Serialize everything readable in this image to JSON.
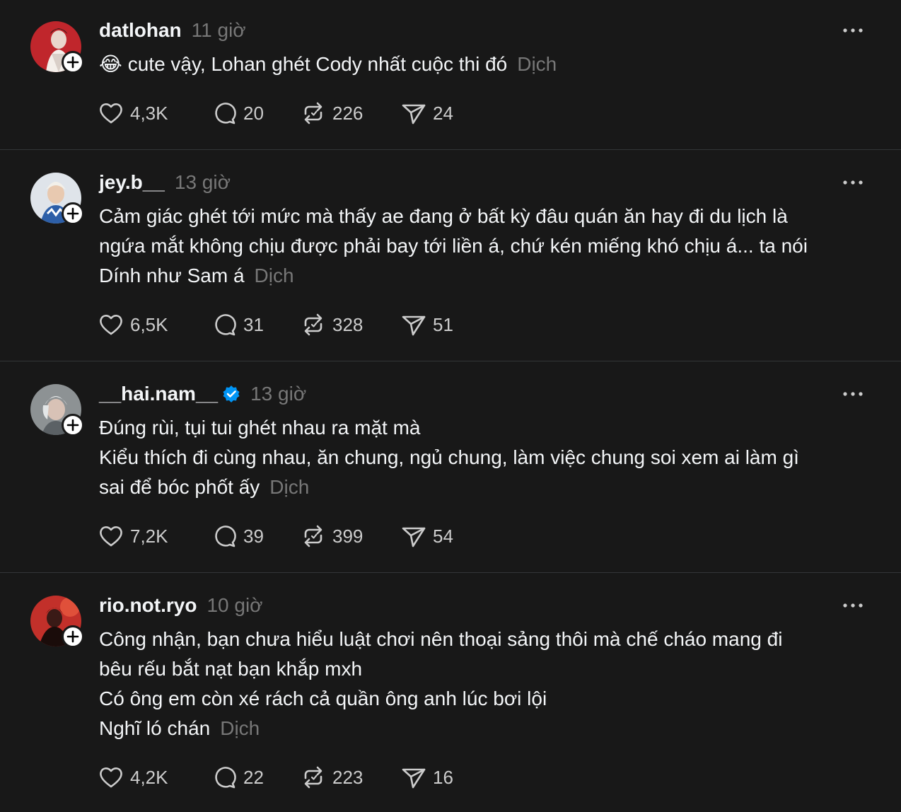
{
  "posts": [
    {
      "username": "datlohan",
      "time": "11 giờ",
      "verified": false,
      "emoji": "😂",
      "lines": [
        "cute vậy, Lohan ghét Cody nhất cuộc thi đó"
      ],
      "translate": "Dịch",
      "likes": "4,3K",
      "replies": "20",
      "reposts": "226",
      "shares": "24"
    },
    {
      "username": "jey.b__",
      "time": "13 giờ",
      "verified": false,
      "lines": [
        "Cảm giác ghét tới mức mà thấy ae đang ở bất kỳ đâu quán ăn hay đi du lịch là",
        "ngứa mắt không chịu được phải bay tới liền á, chứ kén miếng khó chịu á... ta nói",
        "Dính như Sam á"
      ],
      "translate": "Dịch",
      "likes": "6,5K",
      "replies": "31",
      "reposts": "328",
      "shares": "51"
    },
    {
      "username": "__hai.nam__",
      "time": "13 giờ",
      "verified": true,
      "lines": [
        "Đúng rùi, tụi tui ghét nhau ra mặt mà",
        "Kiểu thích đi cùng nhau, ăn chung, ngủ chung, làm việc chung soi xem ai làm gì",
        "sai để bóc phốt ấy"
      ],
      "translate": "Dịch",
      "likes": "7,2K",
      "replies": "39",
      "reposts": "399",
      "shares": "54"
    },
    {
      "username": "rio.not.ryo",
      "time": "10 giờ",
      "verified": false,
      "lines": [
        "Công nhận, bạn chưa hiểu luật chơi nên thoại sảng thôi mà chế cháo mang đi",
        "bêu rếu bắt nạt bạn khắp mxh",
        "Có ông em còn xé rách cả quần ông anh lúc bơi lội",
        "Nghĩ ló chán"
      ],
      "translate": "Dịch",
      "likes": "4,2K",
      "replies": "22",
      "reposts": "223",
      "shares": "16"
    }
  ],
  "colors": {
    "background": "#181818",
    "text": "#f3f5f7",
    "muted": "#777777",
    "divider": "#333638",
    "verified": "#0095f6"
  },
  "icons": {
    "like": "heart-icon",
    "reply": "comment-icon",
    "repost": "repost-icon",
    "share": "send-icon",
    "more": "more-icon",
    "follow": "plus-icon",
    "verified": "verified-badge-icon"
  }
}
